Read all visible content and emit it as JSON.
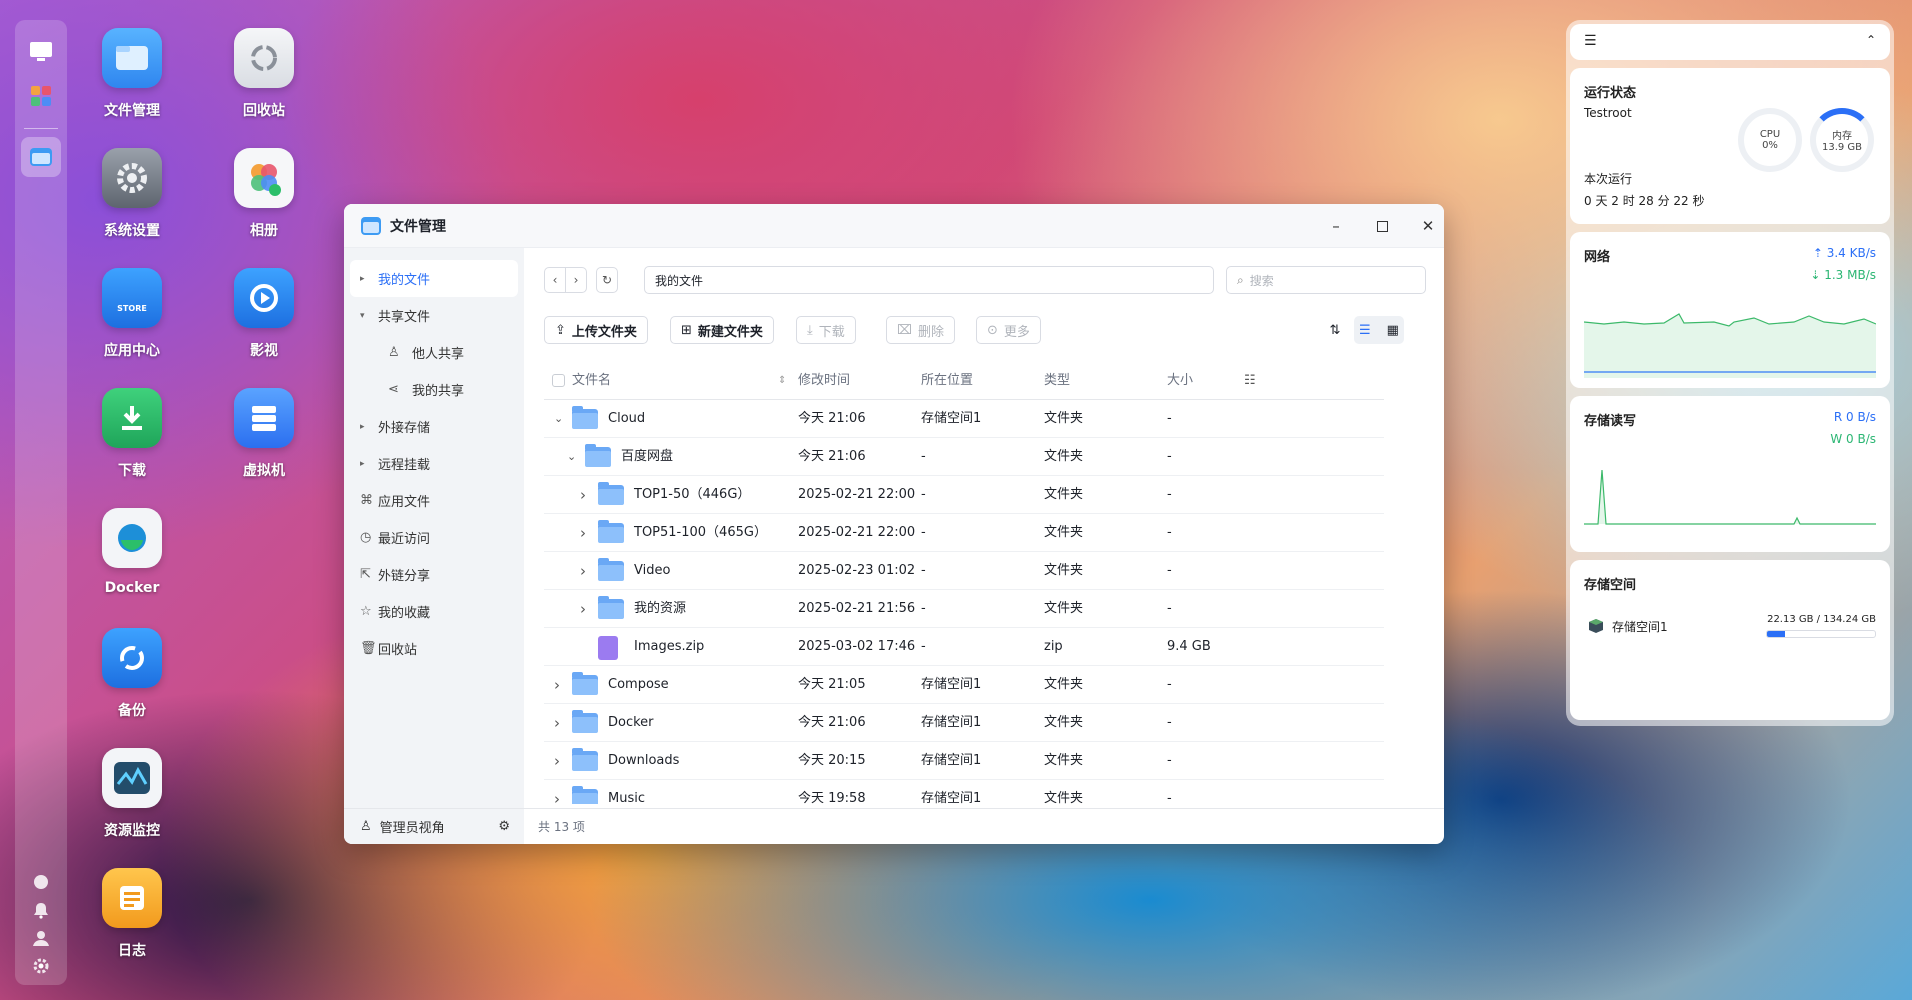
{
  "desktop": {
    "icons": [
      {
        "label": "文件管理"
      },
      {
        "label": "回收站"
      },
      {
        "label": "系统设置"
      },
      {
        "label": "相册"
      },
      {
        "label": "应用中心"
      },
      {
        "label": "影视"
      },
      {
        "label": "下载"
      },
      {
        "label": "虚拟机"
      },
      {
        "label": "Docker"
      },
      {
        "label": "备份"
      },
      {
        "label": "资源监控"
      },
      {
        "label": "日志"
      }
    ],
    "store_text": "STORE"
  },
  "window": {
    "title": "文件管理"
  },
  "sidebar": {
    "items": [
      {
        "label": "我的文件"
      },
      {
        "label": "共享文件"
      },
      {
        "label": "他人共享"
      },
      {
        "label": "我的共享"
      },
      {
        "label": "外接存储"
      },
      {
        "label": "远程挂载"
      },
      {
        "label": "应用文件"
      },
      {
        "label": "最近访问"
      },
      {
        "label": "外链分享"
      },
      {
        "label": "我的收藏"
      },
      {
        "label": "回收站"
      }
    ],
    "footer": "管理员视角"
  },
  "nav": {
    "path": "我的文件",
    "search_placeholder": "搜索"
  },
  "toolbar": {
    "upload": "上传文件夹",
    "new_folder": "新建文件夹",
    "download": "下载",
    "delete": "删除",
    "more": "更多"
  },
  "table": {
    "headers": [
      "文件名",
      "修改时间",
      "所在位置",
      "类型",
      "大小"
    ],
    "rows": [
      {
        "name": "Cloud",
        "time": "今天 21:06",
        "loc": "存储空间1",
        "type": "文件夹",
        "size": "-"
      },
      {
        "name": "百度网盘",
        "time": "今天 21:06",
        "loc": "-",
        "type": "文件夹",
        "size": "-"
      },
      {
        "name": "TOP1-50（446G）",
        "time": "2025-02-21 22:00",
        "loc": "-",
        "type": "文件夹",
        "size": "-"
      },
      {
        "name": "TOP51-100（465G）",
        "time": "2025-02-21 22:00",
        "loc": "-",
        "type": "文件夹",
        "size": "-"
      },
      {
        "name": "Video",
        "time": "2025-02-23 01:02",
        "loc": "-",
        "type": "文件夹",
        "size": "-"
      },
      {
        "name": "我的资源",
        "time": "2025-02-21 21:56",
        "loc": "-",
        "type": "文件夹",
        "size": "-"
      },
      {
        "name": "Images.zip",
        "time": "2025-03-02 17:46",
        "loc": "-",
        "type": "zip",
        "size": "9.4 GB"
      },
      {
        "name": "Compose",
        "time": "今天 21:05",
        "loc": "存储空间1",
        "type": "文件夹",
        "size": "-"
      },
      {
        "name": "Docker",
        "time": "今天 21:06",
        "loc": "存储空间1",
        "type": "文件夹",
        "size": "-"
      },
      {
        "name": "Downloads",
        "time": "今天 20:15",
        "loc": "存储空间1",
        "type": "文件夹",
        "size": "-"
      },
      {
        "name": "Music",
        "time": "今天 19:58",
        "loc": "存储空间1",
        "type": "文件夹",
        "size": "-"
      }
    ]
  },
  "status": {
    "count": "共 13 项"
  },
  "widgets": {
    "run": {
      "title": "运行状态",
      "host": "Testroot",
      "cpu_label": "CPU",
      "cpu_value": "0%",
      "mem_label": "内存",
      "mem_value": "13.9 GB",
      "uptime_label": "本次运行",
      "uptime": "0 天 2 时 28 分 22 秒"
    },
    "net": {
      "title": "网络",
      "up": "3.4 KB/s",
      "down": "1.3 MB/s"
    },
    "disk": {
      "title": "存储读写",
      "read": "R  0 B/s",
      "write": "W  0 B/s"
    },
    "storage": {
      "title": "存储空间",
      "name": "存储空间1",
      "usage": "22.13 GB / 134.24 GB",
      "used_fraction": 0.165
    }
  }
}
